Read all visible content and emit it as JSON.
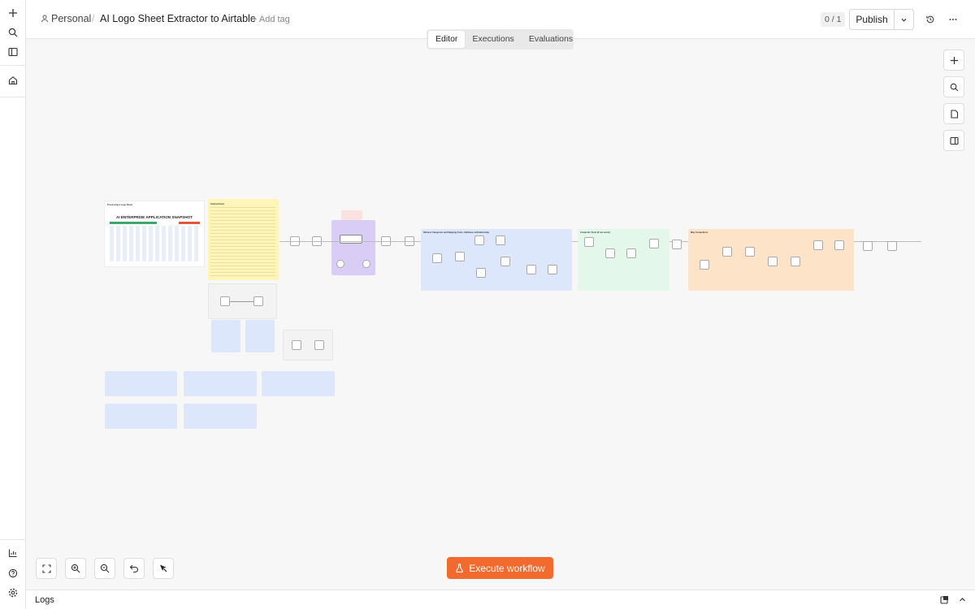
{
  "header": {
    "breadcrumb_parent": "Personal",
    "separator": "/",
    "workflow_title": "AI Logo Sheet Extractor to Airtable",
    "add_tag": "+ Add tag",
    "counter": "0 / 1",
    "publish_label": "Publish"
  },
  "tabs": [
    {
      "label": "Editor",
      "active": true
    },
    {
      "label": "Executions",
      "active": false
    },
    {
      "label": "Evaluations",
      "active": false
    }
  ],
  "canvas": {
    "execute_button": "Execute workflow",
    "sticky_headers": [
      "Instructions",
      "AI ENTERPRISE APPLICATION SNAPSHOT",
      "Retrieve Categories and Mapping Tools, Attributes & Relationship",
      "Create the Tools (if not exists)",
      "Map Competitors"
    ]
  },
  "logs": {
    "label": "Logs"
  },
  "colors": {
    "accent": "#f26a2e",
    "sticky_yellow": "#fff5b8",
    "sticky_blue": "#dce7fb",
    "sticky_green": "#e3f8ea",
    "sticky_orange": "#fde4c8",
    "sticky_purple": "#d9cdf6"
  }
}
